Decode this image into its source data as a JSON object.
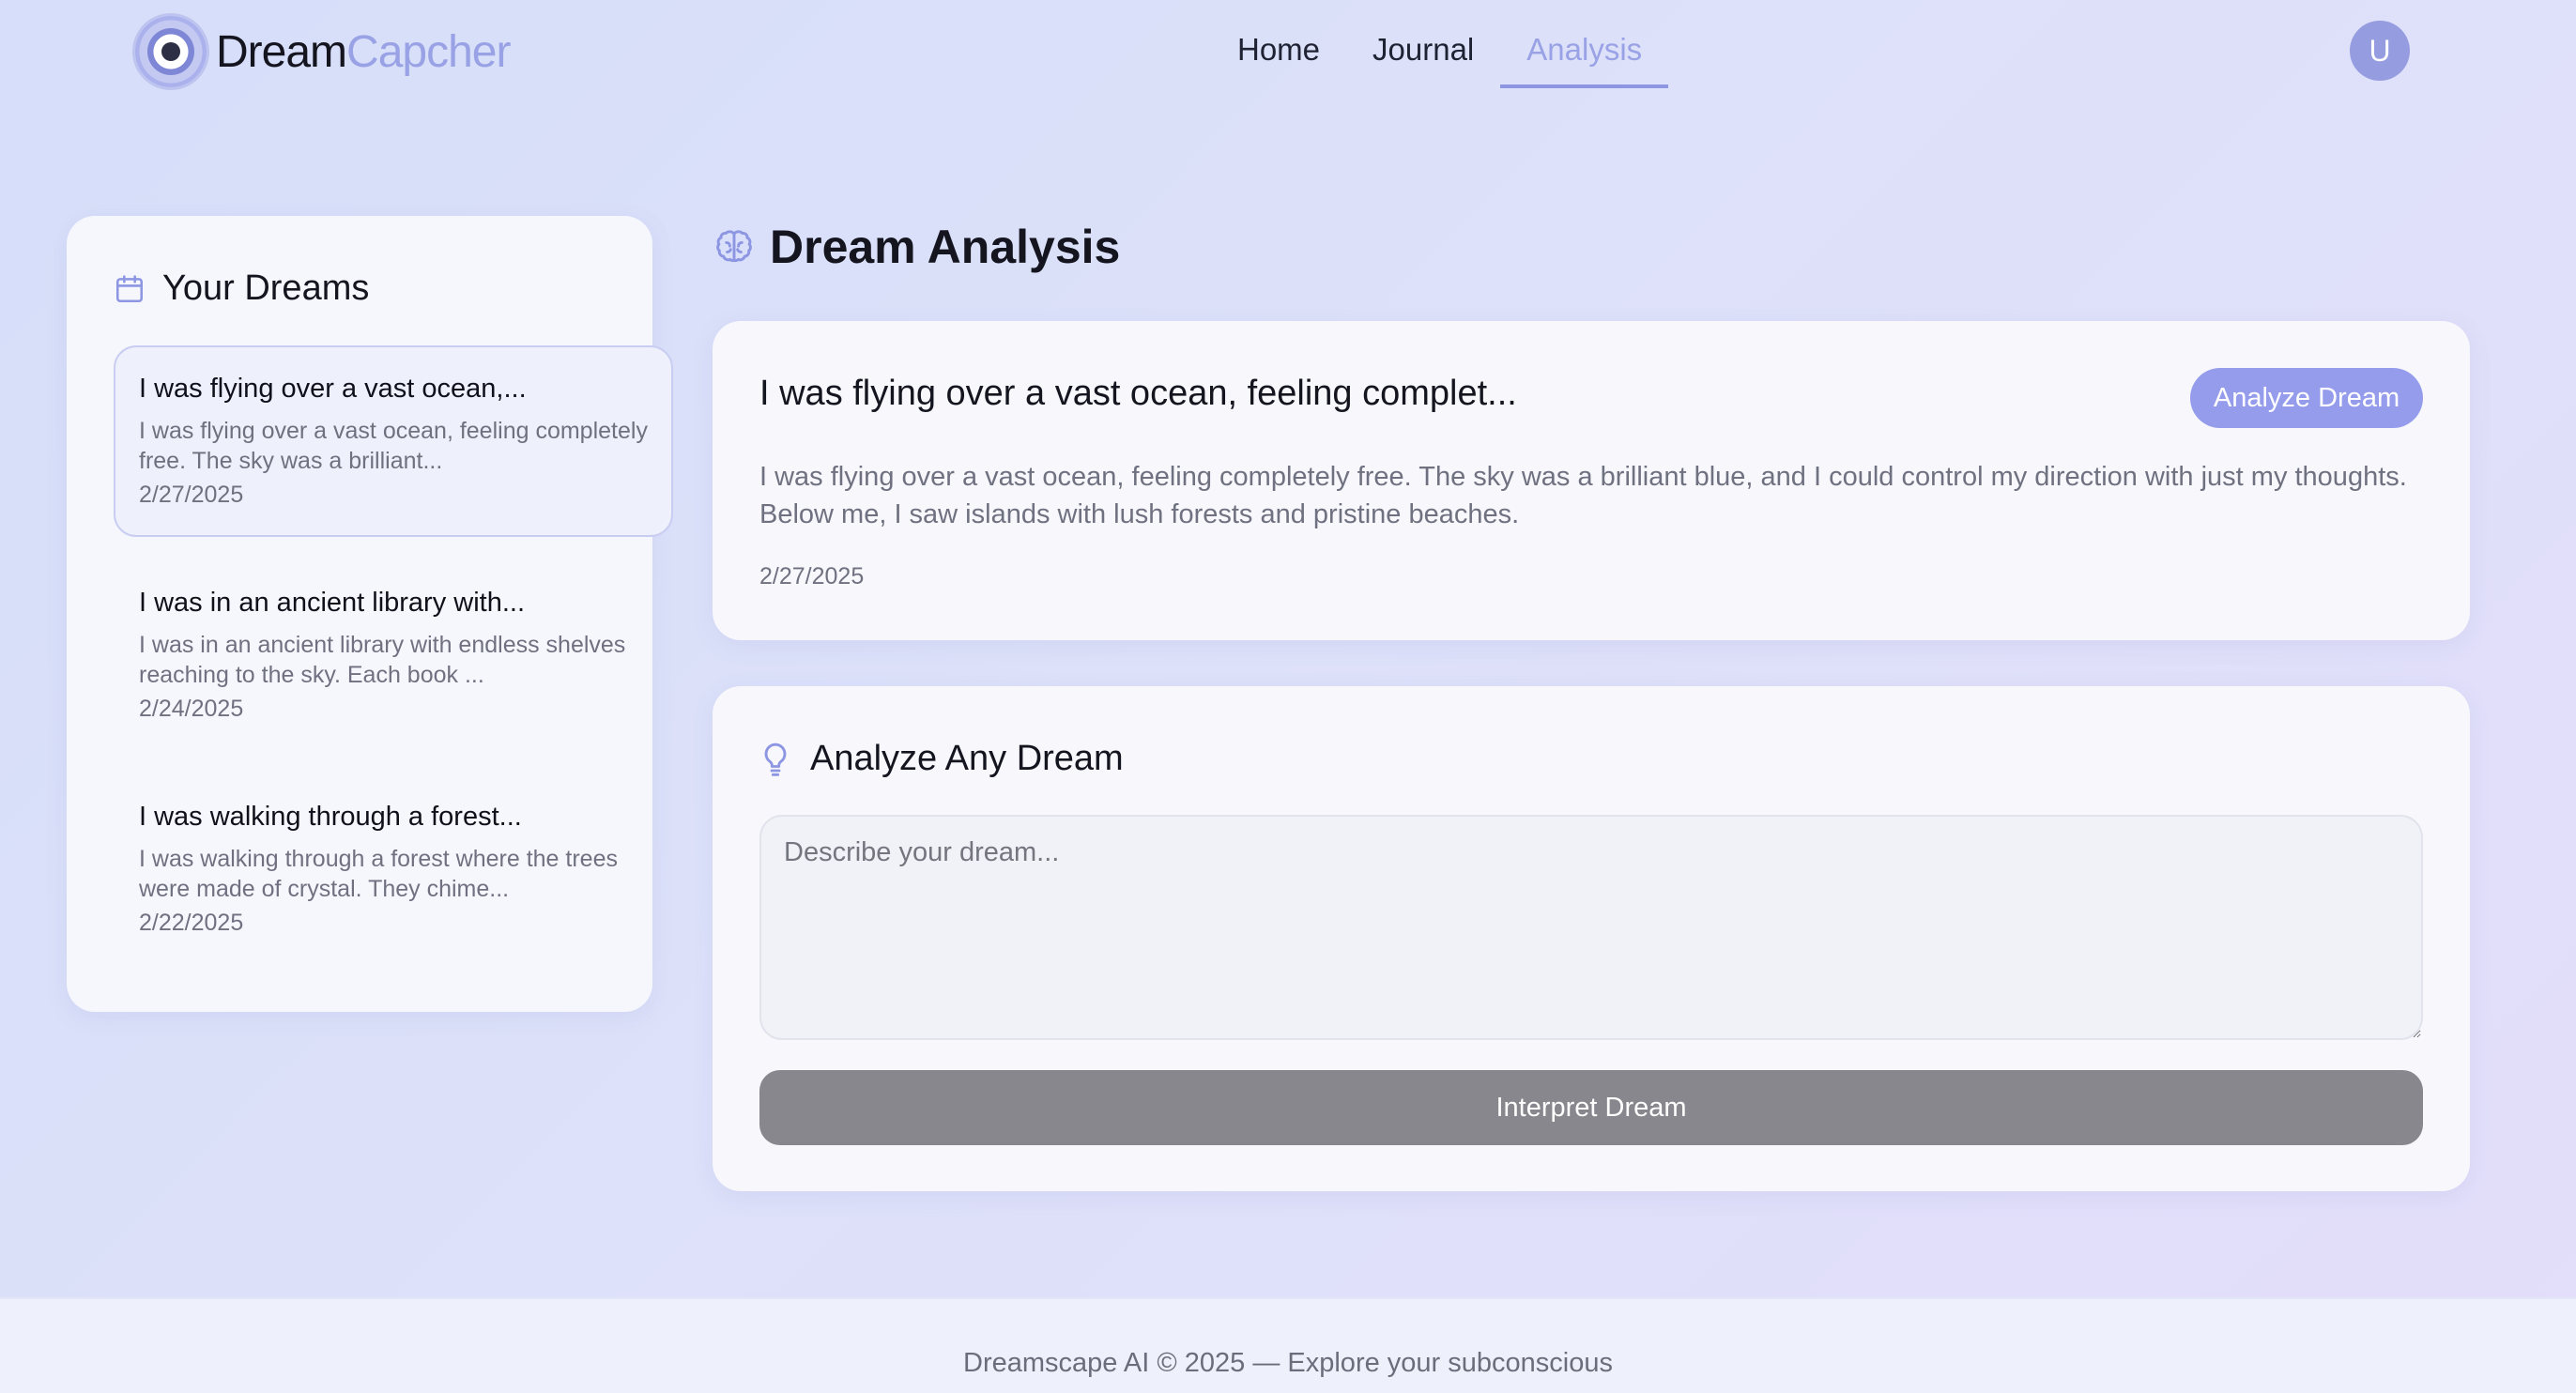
{
  "brand": {
    "part1": "Dream",
    "part2": "Capcher"
  },
  "nav": {
    "items": [
      {
        "label": "Home",
        "active": false
      },
      {
        "label": "Journal",
        "active": false
      },
      {
        "label": "Analysis",
        "active": true
      }
    ]
  },
  "user": {
    "initial": "U"
  },
  "sidebar": {
    "title": "Your Dreams",
    "icon": "calendar-icon",
    "dreams": [
      {
        "title": "I was flying over a vast ocean,...",
        "snippet": "I was flying over a vast ocean, feeling completely free. The sky was a brilliant...",
        "date": "2/27/2025",
        "selected": true
      },
      {
        "title": "I was in an ancient library with...",
        "snippet": "I was in an ancient library with endless shelves reaching to the sky. Each book ...",
        "date": "2/24/2025",
        "selected": false
      },
      {
        "title": "I was walking through a forest...",
        "snippet": "I was walking through a forest where the trees were made of crystal. They chime...",
        "date": "2/22/2025",
        "selected": false
      }
    ]
  },
  "main": {
    "title": "Dream Analysis",
    "icon": "brain-icon",
    "selected_dream": {
      "title": "I was flying over a vast ocean, feeling complet...",
      "text": "I was flying over a vast ocean, feeling completely free. The sky was a brilliant blue, and I could control my direction with just my thoughts. Below me, I saw islands with lush forests and pristine beaches.",
      "date": "2/27/2025",
      "analyze_label": "Analyze Dream"
    },
    "analyze_any": {
      "title": "Analyze Any Dream",
      "icon": "lightbulb-icon",
      "placeholder": "Describe your dream...",
      "value": "",
      "button_label": "Interpret Dream"
    }
  },
  "footer": {
    "text": "Dreamscape AI © 2025 — Explore your subconscious"
  },
  "colors": {
    "accent": "#959cec",
    "nav_active": "#9aa2e6",
    "interpret_button": "#87878d"
  }
}
